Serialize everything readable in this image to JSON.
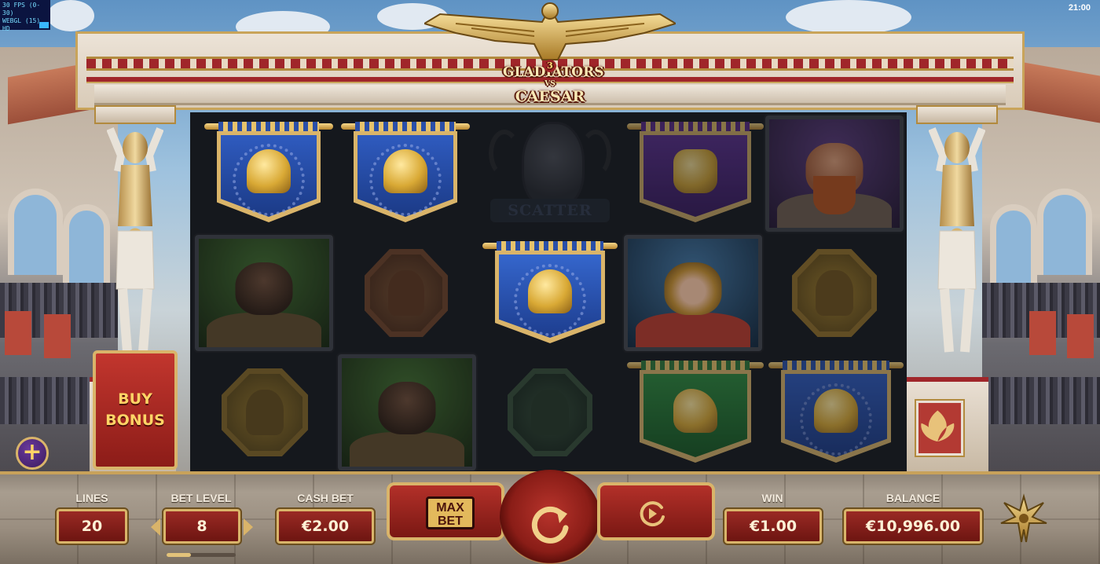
{
  "debug": {
    "fps_line": "30 FPS (0-30)",
    "renderer_line": "WEBGL (15) HD"
  },
  "clock": "21:00",
  "game": {
    "logo": {
      "number": "3",
      "line1": "GLADIATORS",
      "line2": "VS",
      "line3": "CAESAR"
    }
  },
  "reels": {
    "scatter_label": "SCATTER",
    "symbols": [
      {
        "reel": 1,
        "row": 1,
        "type": "banner",
        "variant": "blue-helmet"
      },
      {
        "reel": 2,
        "row": 1,
        "type": "banner",
        "variant": "blue-helmet"
      },
      {
        "reel": 3,
        "row": 1,
        "type": "scatter",
        "variant": "scatter-mask"
      },
      {
        "reel": 4,
        "row": 1,
        "type": "banner",
        "variant": "purple-ram"
      },
      {
        "reel": 5,
        "row": 1,
        "type": "portrait",
        "variant": "red-beard-warrior"
      },
      {
        "reel": 1,
        "row": 2,
        "type": "portrait",
        "variant": "dark-gladiator"
      },
      {
        "reel": 2,
        "row": 2,
        "type": "coin",
        "variant": "bronze-coin"
      },
      {
        "reel": 3,
        "row": 2,
        "type": "banner",
        "variant": "blue-helmet"
      },
      {
        "reel": 4,
        "row": 2,
        "type": "portrait",
        "variant": "female-gladiator"
      },
      {
        "reel": 5,
        "row": 2,
        "type": "coin",
        "variant": "gold-coin"
      },
      {
        "reel": 1,
        "row": 3,
        "type": "coin",
        "variant": "gold-coin"
      },
      {
        "reel": 2,
        "row": 3,
        "type": "portrait",
        "variant": "dark-gladiator"
      },
      {
        "reel": 3,
        "row": 3,
        "type": "coin",
        "variant": "green-coin"
      },
      {
        "reel": 4,
        "row": 3,
        "type": "banner",
        "variant": "green-horse"
      },
      {
        "reel": 5,
        "row": 3,
        "type": "banner",
        "variant": "blue-helmet"
      }
    ]
  },
  "buy_bonus": {
    "line1": "BUY",
    "line2": "BONUS"
  },
  "controls": {
    "lines": {
      "label": "LINES",
      "value": "20"
    },
    "bet_level": {
      "label": "BET LEVEL",
      "value": "8",
      "level_fraction": 0.35
    },
    "cash_bet": {
      "label": "CASH BET",
      "value": "€2.00"
    },
    "max_bet": {
      "line1": "MAX",
      "line2": "BET"
    },
    "win": {
      "label": "WIN",
      "value": "€1.00"
    },
    "balance": {
      "label": "BALANCE",
      "value": "€10,996.00"
    }
  },
  "icons": {
    "plus": "+",
    "spin": "spin-icon",
    "autoplay": "autoplay-icon",
    "settings": "settings-icon"
  },
  "colors": {
    "accent_gold": "#d9b46a",
    "panel_red": "#9a2a24",
    "reel_bg": "#15181d"
  }
}
